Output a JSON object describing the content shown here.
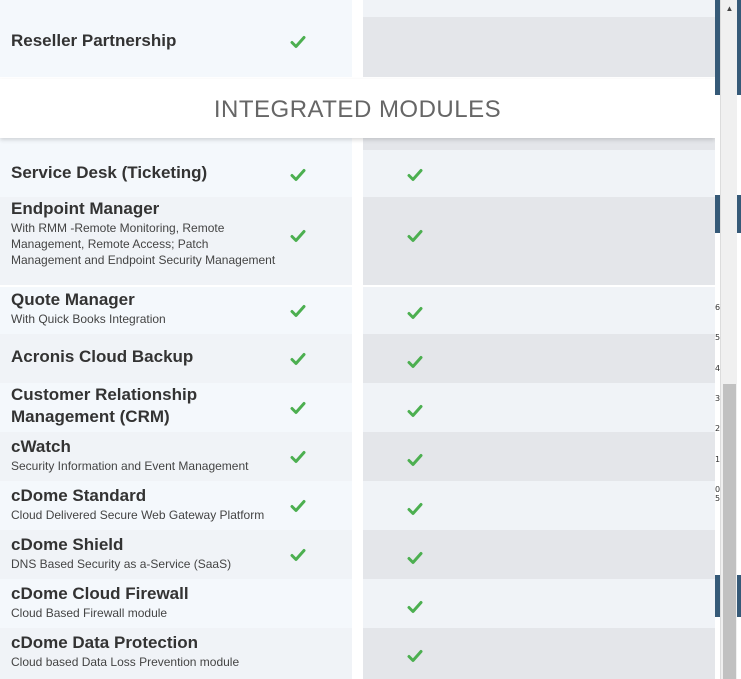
{
  "section_header": "INTEGRATED MODULES",
  "top_row": {
    "title": "Reseller Partnership",
    "col1_check": true,
    "col2_check": false
  },
  "rows": [
    {
      "title": "Service Desk (Ticketing)",
      "subtitle": "",
      "col1_check": true,
      "col2_check": true
    },
    {
      "title": "Endpoint Manager",
      "subtitle": "With RMM -Remote Monitoring, Remote Management, Remote Access; Patch Management and Endpoint Security Management",
      "col1_check": true,
      "col2_check": true
    },
    {
      "title": "Quote Manager",
      "subtitle": "With Quick Books Integration",
      "col1_check": true,
      "col2_check": true
    },
    {
      "title": "Acronis Cloud Backup",
      "subtitle": "",
      "col1_check": true,
      "col2_check": true
    },
    {
      "title": "Customer Relationship Management (CRM)",
      "subtitle": "",
      "col1_check": true,
      "col2_check": true
    },
    {
      "title": "cWatch",
      "subtitle": "Security Information and Event Management",
      "col1_check": true,
      "col2_check": true
    },
    {
      "title": "cDome Standard",
      "subtitle": "Cloud Delivered Secure Web Gateway Platform",
      "col1_check": true,
      "col2_check": true
    },
    {
      "title": "cDome Shield",
      "subtitle": "DNS Based Security as a-Service (SaaS)",
      "col1_check": true,
      "col2_check": true
    },
    {
      "title": "cDome Cloud Firewall",
      "subtitle": "Cloud Based Firewall module",
      "col1_check": false,
      "col2_check": true
    },
    {
      "title": "cDome Data Protection",
      "subtitle": "Cloud based Data Loss Prevention module",
      "col1_check": false,
      "col2_check": true
    }
  ],
  "background_ticks": [
    "6",
    "5",
    "4",
    "3",
    "2",
    "1",
    "0",
    "5"
  ],
  "colors": {
    "check": "#4caf50",
    "light_cell": "#f4f8fc",
    "grey_cell": "#e4e6ea",
    "header_text": "#666666"
  },
  "icons": {
    "check": "check-icon",
    "scroll_up": "scroll-up-arrow-icon"
  },
  "scroll_up_glyph": "▲"
}
